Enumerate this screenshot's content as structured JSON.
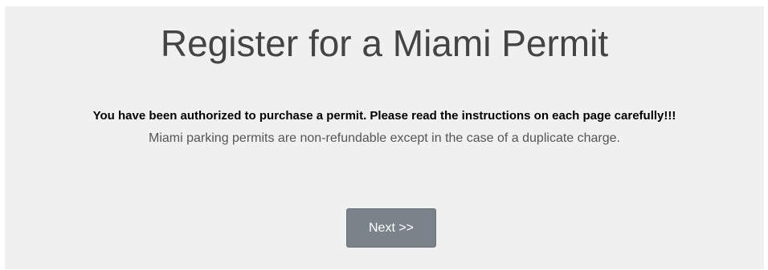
{
  "page": {
    "title": "Register for a Miami Permit",
    "notice": "You have been authorized to purchase a permit. Please read the instructions on each page carefully!!!",
    "subnotice": "Miami parking permits are non-refundable except in the case of a duplicate charge.",
    "next_label": "Next >>"
  },
  "colors": {
    "panel_background": "#f0f0f0",
    "title_text": "#444444",
    "button_background": "#7a828a",
    "button_text": "#ffffff"
  }
}
